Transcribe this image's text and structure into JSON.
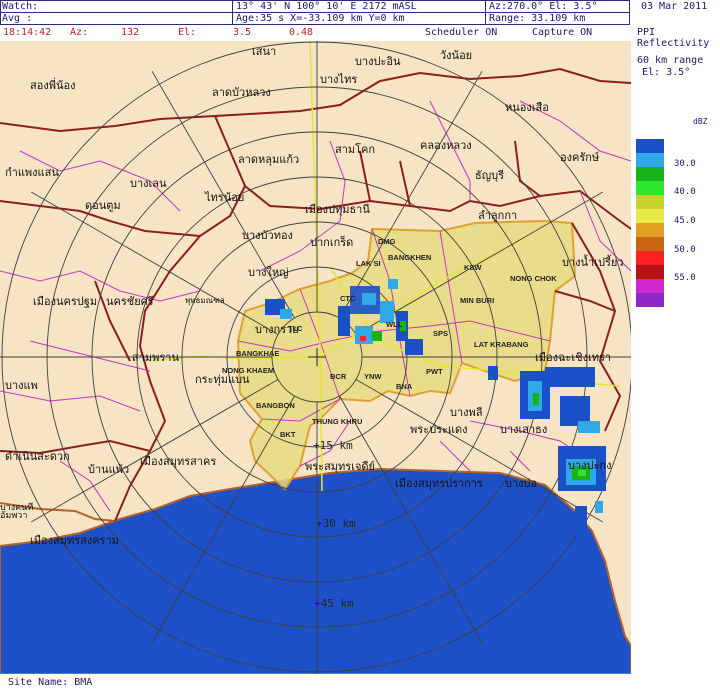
{
  "header": {
    "watch_label": "Watch:",
    "avg_label": "Avg  :",
    "coords": "13° 43' N 100° 10' E  2172 mASL",
    "age": "Age:35 s X=-33.109 km Y=0 km",
    "az_el": "Az:270.0° El:  3.5°",
    "range": "Range: 33.109 km",
    "date": "03 Mar 2011",
    "time": "18:14:42",
    "az_label": "Az:",
    "az_value": "132",
    "el_label": "El:",
    "el_value": "3.5",
    "val": "0.48",
    "scheduler": "Scheduler ON",
    "capture": "Capture ON"
  },
  "legend": {
    "line1": "PPI",
    "line2": "Reflectivity",
    "line3": "60 km range",
    "line4": "El:   3.5°",
    "unit": "dBZ",
    "labels": [
      "30.0",
      "40.0",
      "45.0",
      "50.0",
      "55.0"
    ],
    "colors": [
      "#1a50c8",
      "#2fa8e8",
      "#19b219",
      "#2de62d",
      "#c8d22d",
      "#e8e84a",
      "#e0a020",
      "#c86414",
      "#ff2020",
      "#b41414",
      "#d228d2",
      "#8c28c8"
    ]
  },
  "map": {
    "ring_labels": [
      "+15 km",
      "+30 km",
      "+45 km"
    ],
    "thai_labels": [
      "เสนา",
      "วังน้อย",
      "บางปะอิน",
      "บางไทร",
      "สองพี่น้อง",
      "ลาดบัวหลวง",
      "หนองเสือ",
      "กำแพงแสน",
      "บางเลน",
      "ลาดหลุมแก้ว",
      "สามโคก",
      "คลองหลวง",
      "องครักษ์",
      "ธัญบุรี",
      "ไทรน้อย",
      "เมืองปทุมธานี",
      "ลำลูกกา",
      "ดอนตูม",
      "บางบัวทอง",
      "ปากเกร็ด",
      "บางใหญ่",
      "บางน้ำเปรี้ยว",
      "เมืองนครปฐม",
      "นครชัยศรี",
      "พุทธมณฑล",
      "บางกรวย",
      "สามพราน",
      "เมืองฉะเชิงเทรา",
      "บางแพ",
      "กระทุ่มแบน",
      "บางพลี",
      "ดำเนินสะดวก",
      "บ้านแพ้ว",
      "พระประแดง",
      "บางเสาธง",
      "เมืองสมุทรสาคร",
      "พระสมุทรเจดีย์",
      "บางปะกง",
      "เมืองสมุทรปราการ",
      "บางบ่อ",
      "บางคนที",
      "อัมพวา",
      "เมืองสมุทรสงคราม"
    ],
    "district_labels": [
      "DMG",
      "LAK SI",
      "BANGKHEN",
      "KSW",
      "NONG CHOK",
      "CTC",
      "MIN BURI",
      "WLL",
      "SPS",
      "TLC",
      "LAT KRABANG",
      "BANGKHAE",
      "NONG KHAEM",
      "BCR",
      "YNW",
      "PWT",
      "BNA",
      "BANGBON",
      "THUNG KHRU",
      "BKT"
    ]
  },
  "footer": {
    "site": "Site Name: BMA"
  }
}
